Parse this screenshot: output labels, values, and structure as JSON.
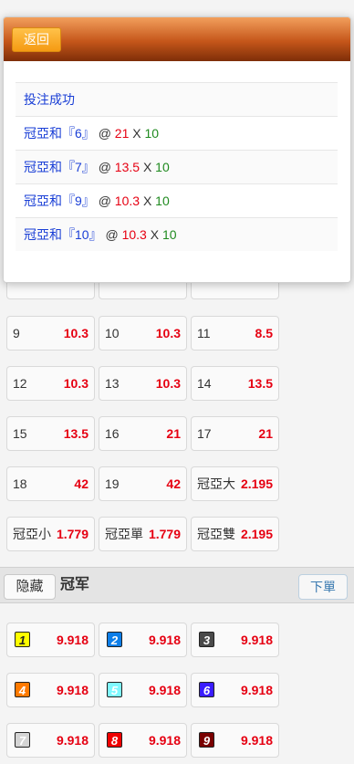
{
  "grid_rows": [
    [
      {
        "name": "9",
        "odds": "10.3"
      },
      {
        "name": "10",
        "odds": "10.3"
      },
      {
        "name": "11",
        "odds": "8.5"
      }
    ],
    [
      {
        "name": "12",
        "odds": "10.3"
      },
      {
        "name": "13",
        "odds": "10.3"
      },
      {
        "name": "14",
        "odds": "13.5"
      }
    ],
    [
      {
        "name": "15",
        "odds": "13.5"
      },
      {
        "name": "16",
        "odds": "21"
      },
      {
        "name": "17",
        "odds": "21"
      }
    ],
    [
      {
        "name": "18",
        "odds": "42"
      },
      {
        "name": "19",
        "odds": "42"
      },
      {
        "name": "冠亞大",
        "odds": "2.195"
      }
    ],
    [
      {
        "name": "冠亞小",
        "odds": "1.779"
      },
      {
        "name": "冠亞單",
        "odds": "1.779"
      },
      {
        "name": "冠亞雙",
        "odds": "2.195"
      }
    ]
  ],
  "section": {
    "hide_label": "隐藏",
    "title": "冠军",
    "order_label": "下單"
  },
  "champion_rows": [
    [
      {
        "num": "1",
        "color": "#ffff00",
        "text_color": "#222",
        "odds": "9.918"
      },
      {
        "num": "2",
        "color": "#0d7ee8",
        "text_color": "#fff",
        "odds": "9.918"
      },
      {
        "num": "3",
        "color": "#4a4a4a",
        "text_color": "#fff",
        "odds": "9.918"
      }
    ],
    [
      {
        "num": "4",
        "color": "#ff7a00",
        "text_color": "#fff",
        "odds": "9.918"
      },
      {
        "num": "5",
        "color": "#7ff8ff",
        "text_color": "#fff",
        "odds": "9.918"
      },
      {
        "num": "6",
        "color": "#3a1cff",
        "text_color": "#fff",
        "odds": "9.918"
      }
    ],
    [
      {
        "num": "7",
        "color": "#d4d4d4",
        "text_color": "#fff",
        "odds": "9.918"
      },
      {
        "num": "8",
        "color": "#f00000",
        "text_color": "#fff",
        "odds": "9.918"
      },
      {
        "num": "9",
        "color": "#7a0000",
        "text_color": "#fff",
        "odds": "9.918"
      }
    ]
  ],
  "dialog": {
    "back_label": "返回",
    "success_text": "投注成功",
    "bets": [
      {
        "label": "冠亞和『6』",
        "at": "@",
        "odds": "21",
        "x": "X",
        "amount": "10"
      },
      {
        "label": "冠亞和『7』",
        "at": "@",
        "odds": "13.5",
        "x": "X",
        "amount": "10"
      },
      {
        "label": "冠亞和『9』",
        "at": "@",
        "odds": "10.3",
        "x": "X",
        "amount": "10"
      },
      {
        "label": "冠亞和『10』",
        "at": "@",
        "odds": "10.3",
        "x": "X",
        "amount": "10"
      }
    ]
  },
  "colors": {
    "odds": "#e60012",
    "label_blue": "#1a3fd6",
    "amount_green": "#1f8a1f",
    "header_orange": "#c5561a"
  }
}
